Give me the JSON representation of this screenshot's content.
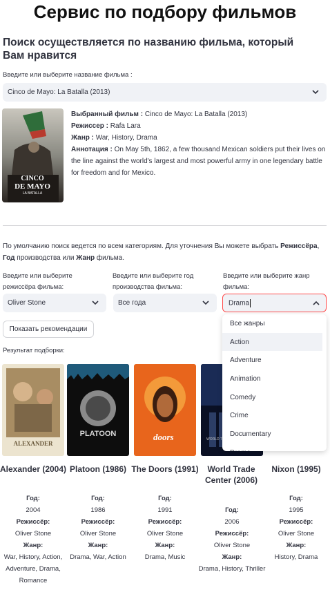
{
  "title": "Сервис по подбору фильмов",
  "subtitle": "Поиск осуществляется по названию фильма, который Вам нравится",
  "film_select": {
    "label": "Введите или выберите название фильма :",
    "value": "Cinco de Mayo: La Batalla (2013)"
  },
  "selected_film": {
    "film_label": "Выбранный фильм :",
    "film_value": "Cinco de Mayo: La Batalla (2013)",
    "director_label": "Режиссер :",
    "director_value": "Rafa Lara",
    "genre_label": "Жанр :",
    "genre_value": "War, History, Drama",
    "annotation_label": "Аннотация :",
    "annotation_value": "On May 5th, 1862, a few thousand Mexican soldiers put their lives on the line against the world's largest and most powerful army in one legendary battle for freedom and for Mexico.",
    "poster_text": [
      "CINCO",
      "DE MAYO",
      "LA BATALLA"
    ]
  },
  "description": {
    "part1": "По умолчанию поиск ведется по всем категориям. Для уточнения Вы можете выбрать ",
    "director": "Режиссёра",
    "sep1": ", ",
    "year": "Год",
    "part2": " производства или ",
    "genre": "Жанр",
    "part3": " фильма."
  },
  "filters": {
    "director": {
      "label": "Введите или выберите режиссёра фильма:",
      "value": "Oliver Stone"
    },
    "year": {
      "label": "Введите или выберите год производства фильма:",
      "value": "Все года"
    },
    "genre": {
      "label": "Введите или выберите жанр фильма:",
      "value": "Drama"
    }
  },
  "genre_options": [
    "Все жанры",
    "Action",
    "Adventure",
    "Animation",
    "Comedy",
    "Crime",
    "Documentary",
    "Drama"
  ],
  "genre_highlighted": "Action",
  "button_label": "Показать рекомендации",
  "results_label": "Результат подборки:",
  "meta_labels": {
    "year": "Год:",
    "director": "Режиссёр:",
    "genre": "Жанр:"
  },
  "results": [
    {
      "title": "Alexander (2004)",
      "year": "2004",
      "director": "Oliver Stone",
      "genre": "War, History, Action, Adventure, Drama, Romance",
      "poster_text": "ALEXANDER"
    },
    {
      "title": "Platoon (1986)",
      "year": "1986",
      "director": "Oliver Stone",
      "genre": "Drama, War, Action",
      "poster_text": "PLATOON"
    },
    {
      "title": "The Doors (1991)",
      "year": "1991",
      "director": "Oliver Stone",
      "genre": "Drama, Music",
      "poster_text": "doors"
    },
    {
      "title": "World Trade Center (2006)",
      "year": "2006",
      "director": "Oliver Stone",
      "genre": "Drama, History, Thriller",
      "poster_text": "WORLD TRADE CENTER"
    },
    {
      "title": "Nixon (1995)",
      "year": "1995",
      "director": "Oliver Stone",
      "genre": "History, Drama",
      "poster_text": ""
    }
  ],
  "colors": {
    "accent": "#ff4b4b",
    "input_bg": "#f0f2f6",
    "text": "#31333f"
  }
}
